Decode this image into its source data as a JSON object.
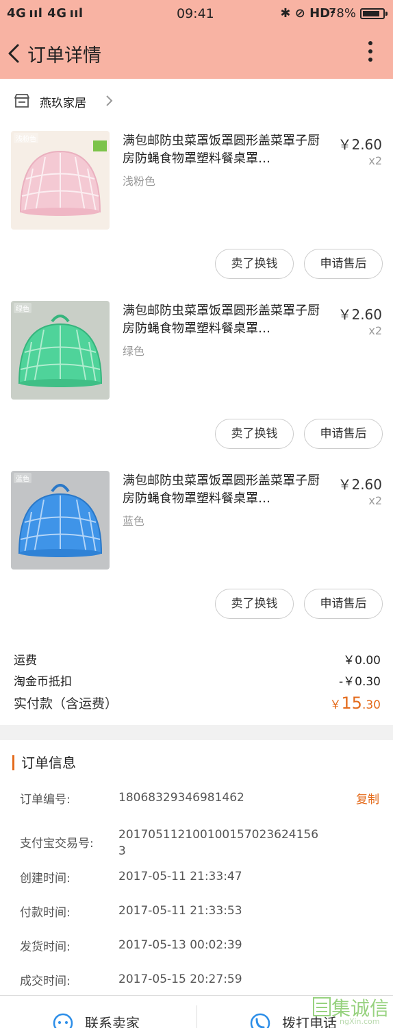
{
  "status_bar": {
    "left": "4G ııl 4G ııl",
    "time": "09:41",
    "right": "✱ ⊘ HD²",
    "battery": "78%"
  },
  "header": {
    "title": "订单详情"
  },
  "shop": {
    "name": "燕玖家居"
  },
  "items": [
    {
      "title": "满包邮防虫菜罩饭罩圆形盖菜罩子厨房防蝇食物罩塑料餐桌罩…",
      "variant": "浅粉色",
      "thumb_tag": "浅粉色",
      "price": "￥2.60",
      "qty": "x2",
      "color": "#f4c9d3",
      "actions": {
        "sell": "卖了换钱",
        "after_sale": "申请售后"
      }
    },
    {
      "title": "满包邮防虫菜罩饭罩圆形盖菜罩子厨房防蝇食物罩塑料餐桌罩…",
      "variant": "绿色",
      "thumb_tag": "绿色",
      "price": "￥2.60",
      "qty": "x2",
      "color": "#4fd39a",
      "actions": {
        "sell": "卖了换钱",
        "after_sale": "申请售后"
      }
    },
    {
      "title": "满包邮防虫菜罩饭罩圆形盖菜罩子厨房防蝇食物罩塑料餐桌罩…",
      "variant": "蓝色",
      "thumb_tag": "蓝色",
      "price": "￥2.60",
      "qty": "x2",
      "color": "#3f94e8",
      "actions": {
        "sell": "卖了换钱",
        "after_sale": "申请售后"
      }
    }
  ],
  "totals": {
    "shipping_label": "运费",
    "shipping_value": "￥0.00",
    "coin_label": "淘金币抵扣",
    "coin_value": "-￥0.30",
    "paid_label": "实付款（含运费）",
    "paid_currency": "￥",
    "paid_int": "15",
    "paid_dec": ".30"
  },
  "order_info": {
    "title": "订单信息",
    "copy_label": "复制",
    "rows": [
      {
        "label": "订单编号:",
        "value": "1806832934698146​2"
      },
      {
        "label": "支付宝交易号:",
        "value": "2017051121001001570236241563"
      },
      {
        "label": "创建时间:",
        "value": "2017-05-11 21:33:47"
      },
      {
        "label": "付款时间:",
        "value": "2017-05-11 21:33:53"
      },
      {
        "label": "发货时间:",
        "value": "2017-05-13 00:02:39"
      },
      {
        "label": "成交时间:",
        "value": "2017-05-15 20:27:59"
      }
    ]
  },
  "bottom_bar": {
    "contact_seller": "联系卖家",
    "call_phone": "拨打电话"
  },
  "watermark": {
    "text": "集诚信",
    "url": "ngXin.com"
  },
  "colors": {
    "header_bg": "#f8b3a3",
    "accent": "#e46b1c"
  }
}
